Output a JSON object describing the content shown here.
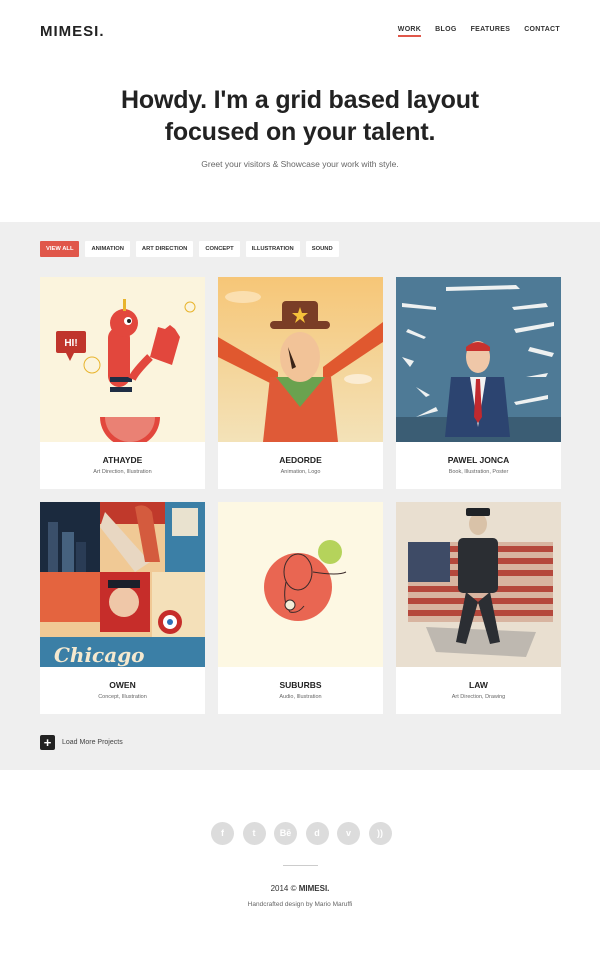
{
  "header": {
    "logo": "MIMESI.",
    "nav": [
      {
        "label": "WORK",
        "active": true
      },
      {
        "label": "BLOG",
        "active": false
      },
      {
        "label": "FEATURES",
        "active": false
      },
      {
        "label": "CONTACT",
        "active": false
      }
    ]
  },
  "hero": {
    "title_line1": "Howdy. I'm a grid based layout",
    "title_line2": "focused on your talent.",
    "subtitle": "Greet your visitors & Showcase your work with style."
  },
  "filters": [
    "VIEW ALL",
    "ANIMATION",
    "ART DIRECTION",
    "CONCEPT",
    "ILLUSTRATION",
    "SOUND"
  ],
  "projects": [
    {
      "title": "ATHAYDE",
      "tags": "Art Direction, Illustration"
    },
    {
      "title": "AEDORDE",
      "tags": "Animation, Logo"
    },
    {
      "title": "PAWEL JONCA",
      "tags": "Book, Illustration, Poster"
    },
    {
      "title": "OWEN",
      "tags": "Concept, Illustration"
    },
    {
      "title": "SUBURBS",
      "tags": "Audio, Illustration"
    },
    {
      "title": "LAW",
      "tags": "Art Direction, Drawing"
    }
  ],
  "artwork_text": {
    "bubble": "HI!",
    "sign": "Chicago"
  },
  "load_more": {
    "icon": "+",
    "label": "Load More Projects"
  },
  "footer": {
    "socials": [
      {
        "name": "facebook-icon",
        "glyph": "f"
      },
      {
        "name": "twitter-icon",
        "glyph": "t"
      },
      {
        "name": "behance-icon",
        "glyph": "Bē"
      },
      {
        "name": "dribbble-icon",
        "glyph": "d"
      },
      {
        "name": "vimeo-icon",
        "glyph": "v"
      },
      {
        "name": "rss-icon",
        "glyph": "))"
      }
    ],
    "copyright_prefix": "2014 ©",
    "copyright_brand": "MIMESI.",
    "credit": "Handcrafted design by Mario Maruffi"
  },
  "colors": {
    "accent": "#e0574a",
    "section_bg": "#efefef"
  }
}
